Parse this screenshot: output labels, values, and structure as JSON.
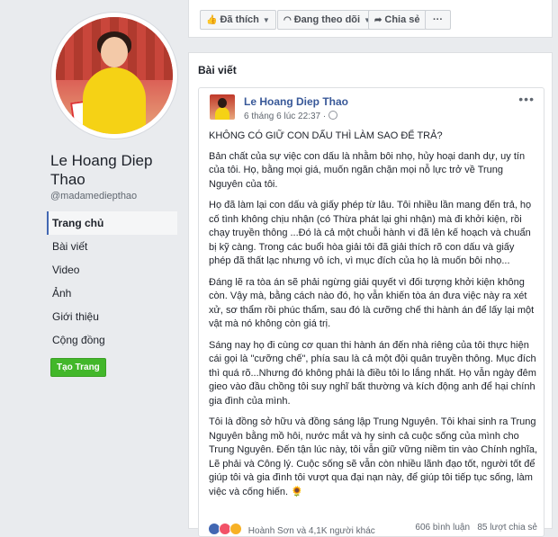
{
  "profile": {
    "name": "Le Hoang Diep Thao",
    "handle": "@madamediepthao"
  },
  "nav": {
    "items": [
      {
        "label": "Trang chủ"
      },
      {
        "label": "Bài viết"
      },
      {
        "label": "Video"
      },
      {
        "label": "Ảnh"
      },
      {
        "label": "Giới thiệu"
      },
      {
        "label": "Cộng đồng"
      }
    ],
    "create_page": "Tạo Trang"
  },
  "topbar": {
    "liked": "Đã thích",
    "following": "Đang theo dõi",
    "share": "Chia sẻ",
    "more": "···"
  },
  "posts_section": {
    "title": "Bài viết"
  },
  "post": {
    "author": "Le Hoang Diep Thao",
    "time": "6 tháng 6 lúc 22:37 ·",
    "menu": "•••",
    "headline": "KHÔNG CÓ GIỮ CON DẤU THÌ LÀM SAO ĐỂ TRẢ?",
    "paragraphs": [
      "Bản chất của sự việc con dấu là nhằm bôi nhọ, hủy hoại danh dự, uy tín của tôi. Họ, bằng mọi giá, muốn ngăn chặn mọi nỗ lực trở về Trung Nguyên của tôi.",
      "Họ đã làm lại con dấu và giấy phép từ lâu. Tôi nhiều lần mang đến trả, họ cố tình không chịu nhận (có Thừa phát lại ghi nhận) mà đi khởi kiện, rồi chạy truyền thông ...Đó là cả một chuỗi hành vi đã lên kế hoạch và chuẩn bị kỹ càng. Trong các buổi hòa giải tôi đã giải thích rõ con dấu và giấy phép đã thất lạc nhưng vô ích, vì mục đích của họ là muốn bôi nhọ...",
      "Đáng lẽ ra tòa án sẽ phải ngừng giải quyết vì đối tượng khởi kiện không còn. Vậy mà, bằng cách nào đó, họ vẫn khiến tòa án đưa việc này ra xét xử, sơ thẩm rồi phúc thẩm, sau đó là cưỡng chế thi hành án để lấy lại một vật mà nó không còn giá trị.",
      "Sáng nay họ đi cùng cơ quan thi hành án đến nhà riêng của tôi thực hiện cái gọi là \"cưỡng chế\", phía sau là cả một đội quân truyền thông. Mục đích thì quá rõ...Nhưng đó không phải là điều tôi lo lắng nhất. Họ vẫn ngày đêm gieo vào đầu chồng tôi suy nghĩ bất thường và kích động anh để hại chính gia đình của mình.",
      "Tôi là đồng sở hữu và đồng sáng lập Trung Nguyên. Tôi khai sinh ra Trung Nguyên bằng mồ hôi, nước mắt và hy sinh cả cuộc sống của mình cho Trung Nguyên. Đến tận lúc này, tôi vẫn giữ vững niềm tin vào Chính nghĩa, Lẽ phải và Công lý. Cuộc sống sẽ vẫn còn nhiều lãnh đạo tốt, người tốt để giúp tôi và gia đình tôi vượt qua đại nạn này, để giúp tôi tiếp tục sống, làm việc và cống hiến. 🌻"
    ],
    "reactors": "Hoành Sơn và 4,1K người khác",
    "comments": "606 bình luận",
    "shares": "85 lượt chia sẻ"
  },
  "colors": {
    "background": "#e9ebee",
    "link": "#385898",
    "create_button": "#42b72a"
  },
  "icons": [
    "like-icon",
    "rss-icon",
    "share-icon",
    "globe-icon",
    "more-icon"
  ]
}
